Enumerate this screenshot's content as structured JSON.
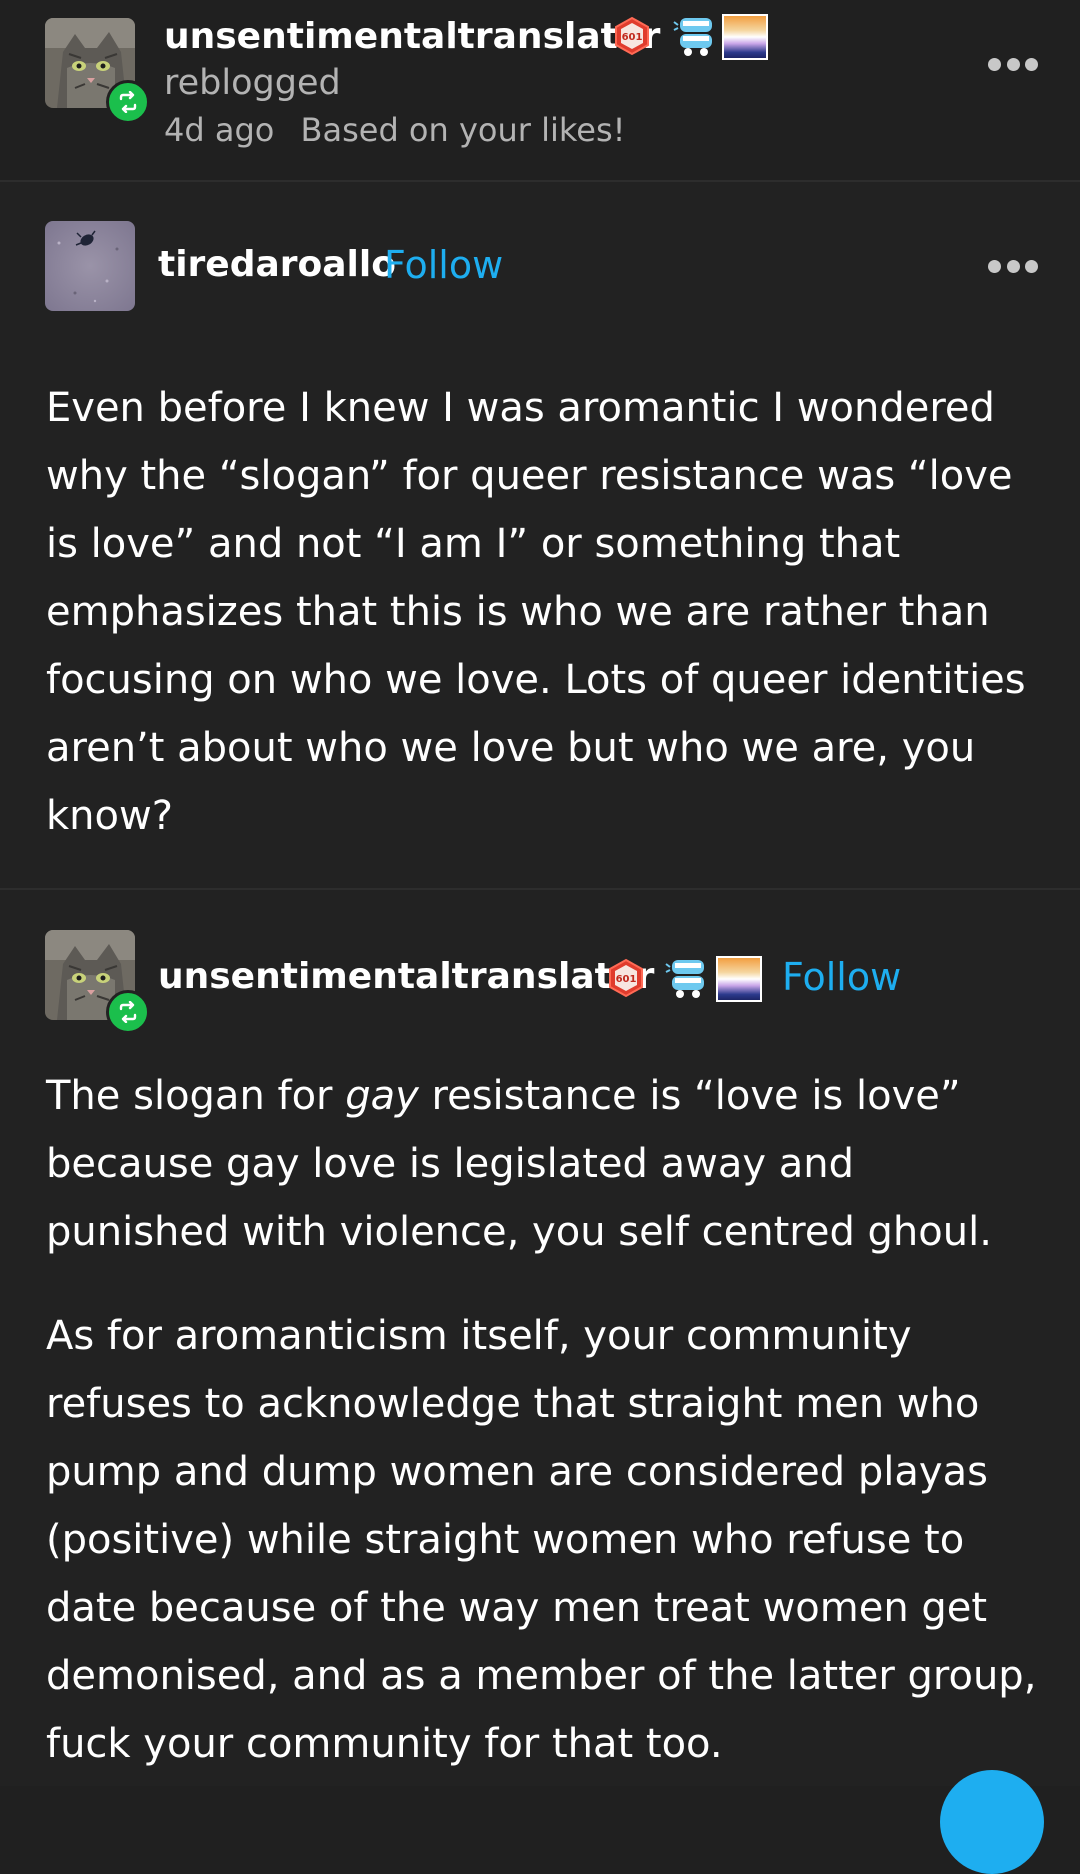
{
  "reblog_header": {
    "username": "unsentimentaltranslator",
    "action": "reblogged",
    "time": "4d ago",
    "reason": "Based on your likes!",
    "badge_count": "601"
  },
  "original_post": {
    "username": "tiredaroallo",
    "follow_label": "Follow",
    "text": "Even before I knew I was aromantic I wondered why the “slogan” for queer resistance was “love is love” and not “I am I” or something that emphasizes that this is who we are rather than focusing on who we love. Lots of queer identities aren’t about who we love but who we are, you know?"
  },
  "reply_post": {
    "username": "unsentimentaltranslator",
    "badge_count": "601",
    "follow_label": "Follow",
    "para1_before": "The slogan for ",
    "para1_emph": "gay",
    "para1_after": " resistance is “love is love” because gay love is legislated away and punished with violence, you self centred ghoul.",
    "para2": "As for aromanticism itself, your community refuses to acknowledge that straight men who pump and dump women are considered playas (positive) while straight women who refuse to date because of the way men treat women get demonised, and as a member of the latter group, fuck your community for that too."
  },
  "colors": {
    "background": "#202020",
    "accent_blue": "#1eaef0",
    "reblog_green": "#1bbf4c",
    "muted_text": "#b3b3b3"
  },
  "icons": {
    "reblog": "reblog-arrows-icon",
    "more": "more-horizontal-icon",
    "badge_count": "hexagon-count-badge",
    "badge_teeth": "chattering-teeth-badge",
    "badge_gradient": "sunset-gradient-badge"
  }
}
